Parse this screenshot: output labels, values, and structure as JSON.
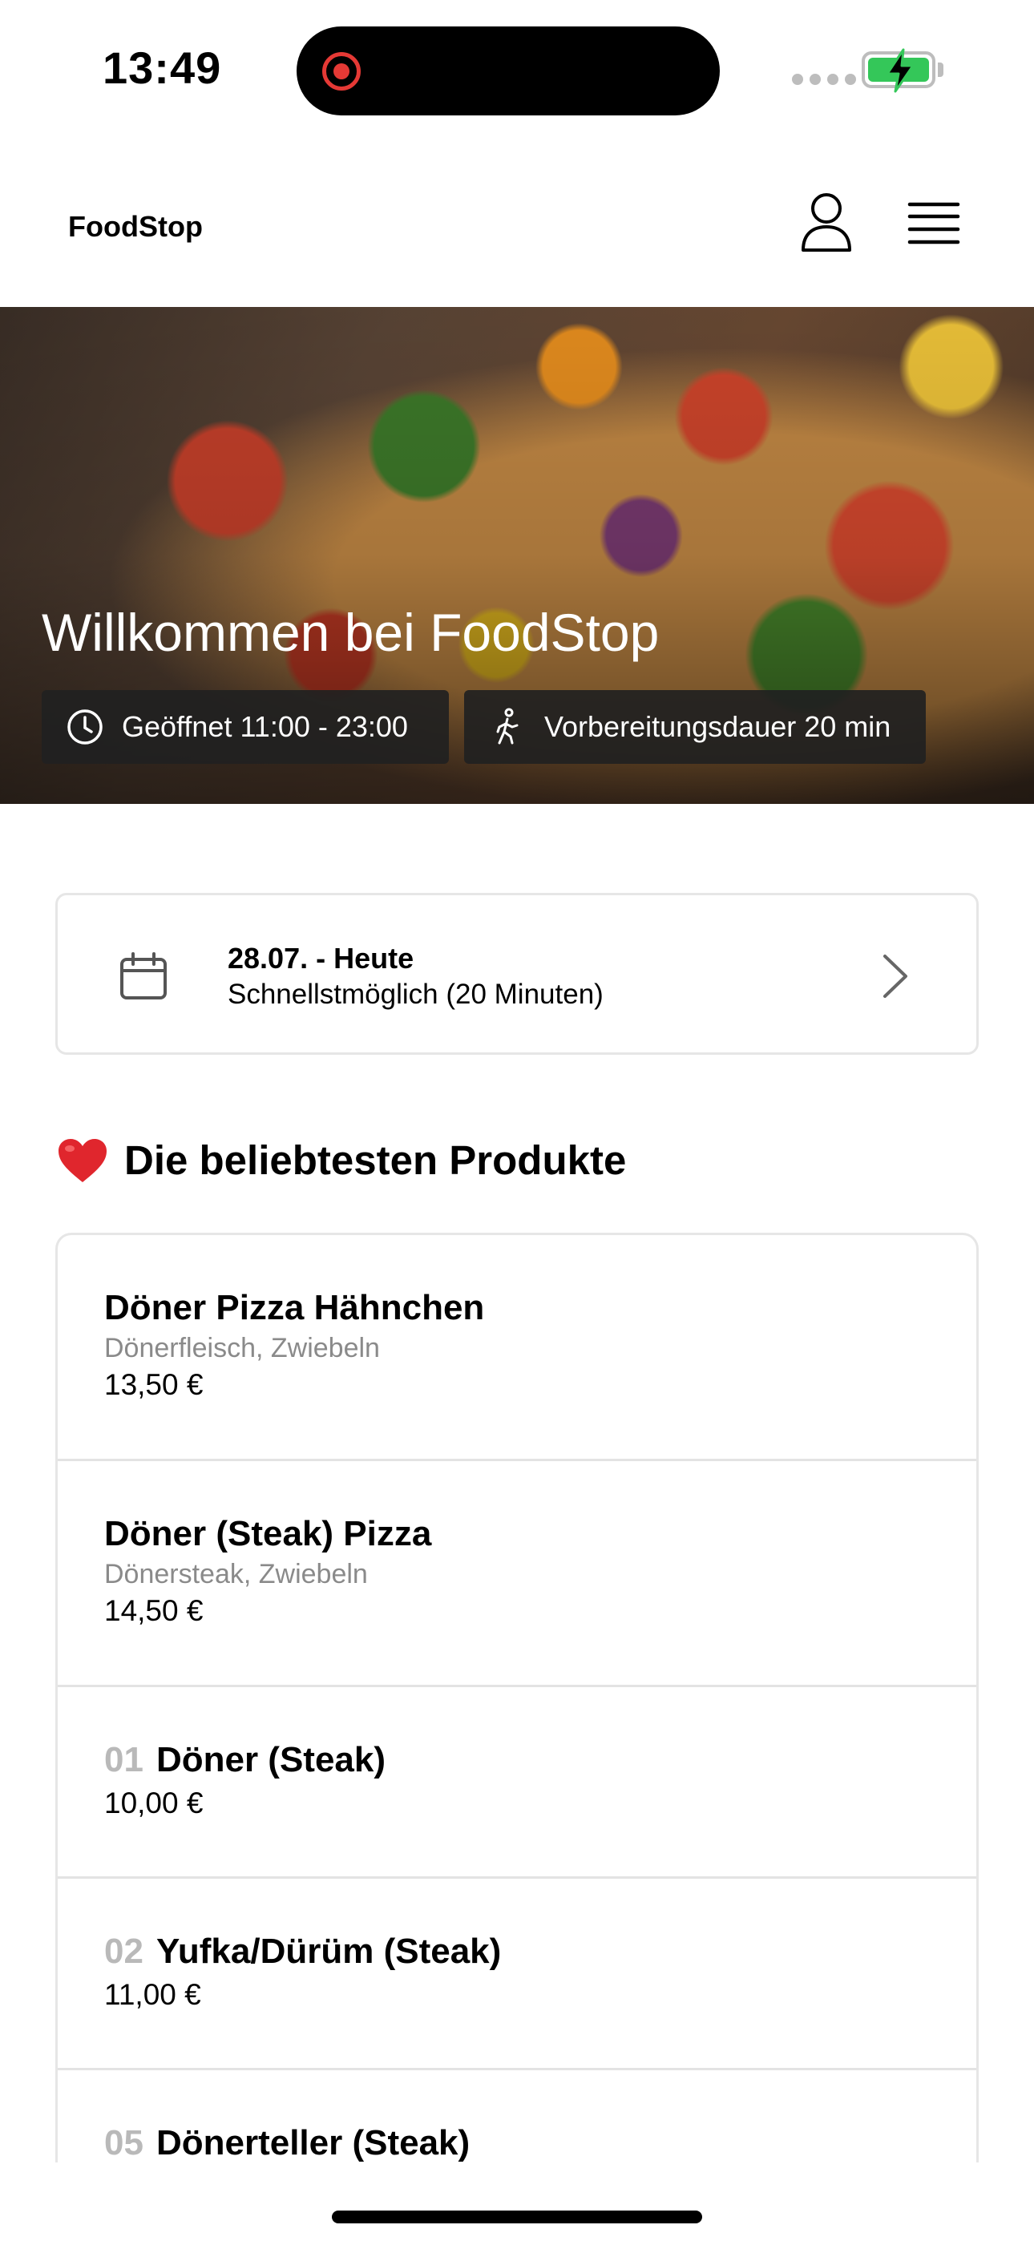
{
  "status_bar": {
    "time": "13:49"
  },
  "header": {
    "brand": "FoodStop"
  },
  "hero": {
    "title": "Willkommen bei FoodStop",
    "open_hours": "Geöffnet 11:00 - 23:00",
    "prep_time": "Vorbereitungsdauer 20 min"
  },
  "date_selector": {
    "date": "28.07. - Heute",
    "time": "Schnellstmöglich (20 Minuten)"
  },
  "popular": {
    "title": "Die beliebtesten Produkte",
    "items": [
      {
        "number": "",
        "name": "Döner Pizza Hähnchen",
        "desc": "Dönerfleisch, Zwiebeln",
        "price": "13,50 €"
      },
      {
        "number": "",
        "name": "Döner (Steak) Pizza",
        "desc": "Dönersteak, Zwiebeln",
        "price": "14,50 €"
      },
      {
        "number": "01",
        "name": "Döner (Steak)",
        "desc": "",
        "price": "10,00 €"
      },
      {
        "number": "02",
        "name": "Yufka/Dürüm (Steak)",
        "desc": "",
        "price": "11,00 €"
      },
      {
        "number": "05",
        "name": "Dönerteller (Steak)",
        "desc": "",
        "price": ""
      }
    ]
  },
  "colors": {
    "battery": "#34c759",
    "record": "#e53935",
    "chip_bg": "#212121"
  }
}
